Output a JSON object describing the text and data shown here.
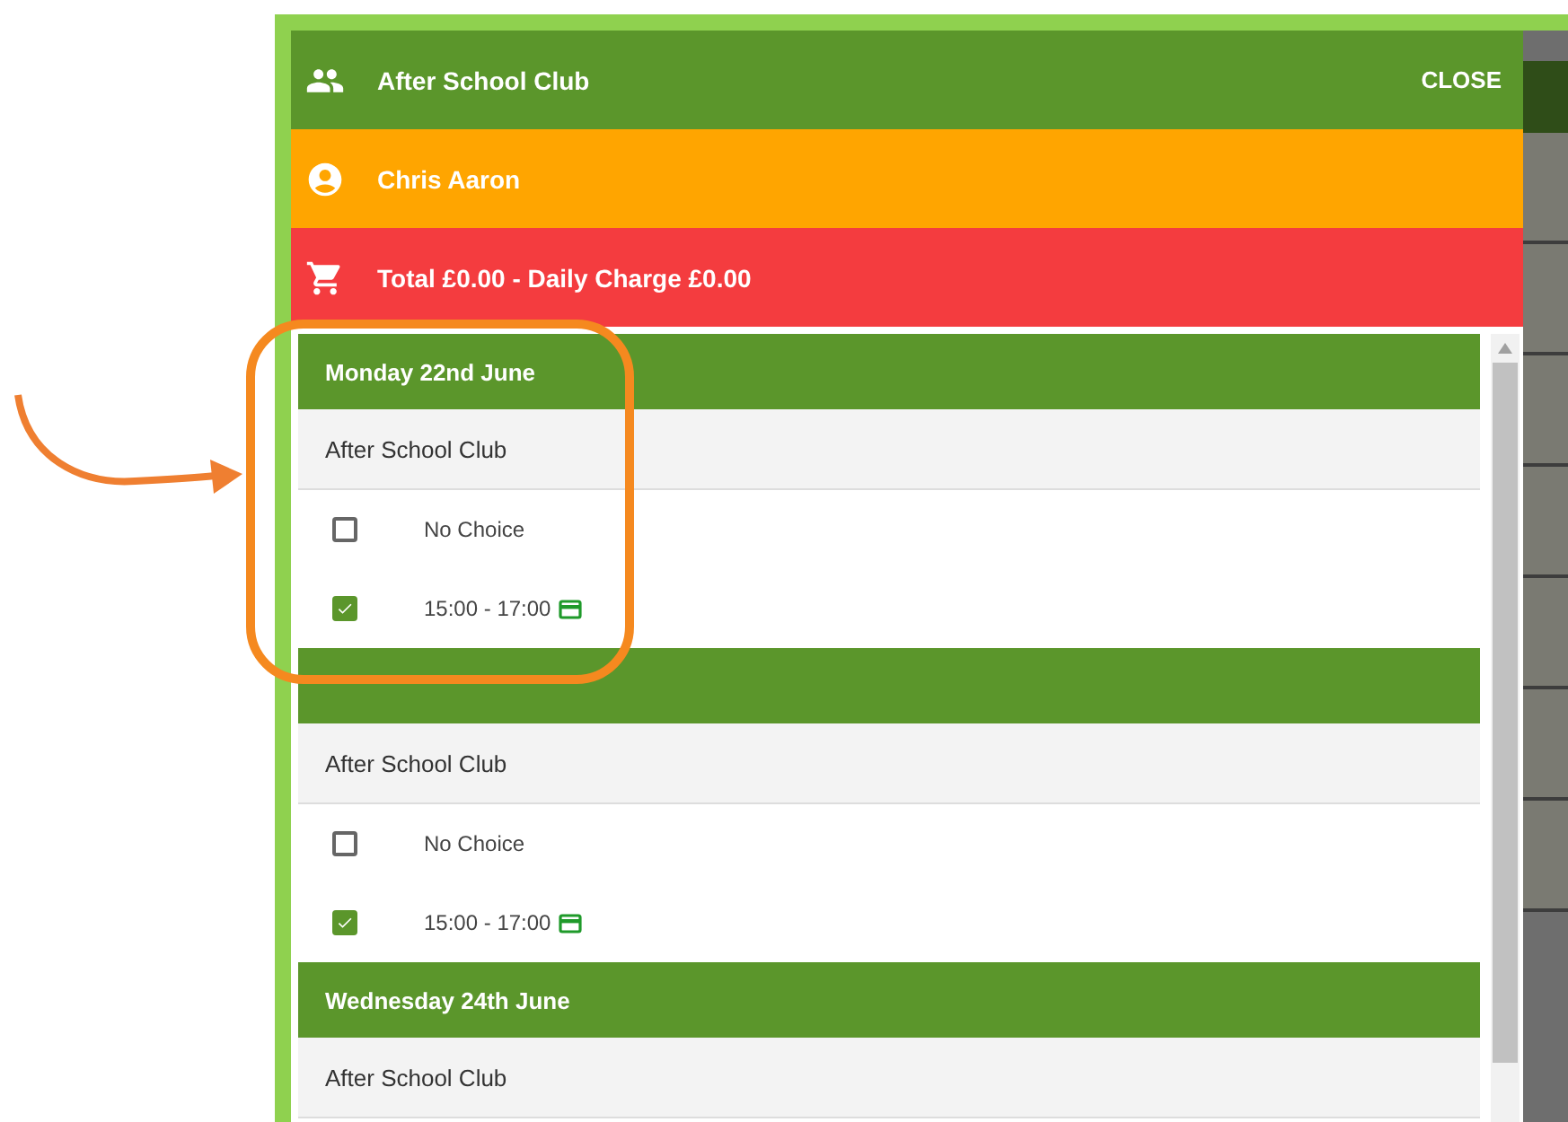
{
  "dialog": {
    "title": "After School Club",
    "close_label": "CLOSE",
    "pupil": "Chris Aaron",
    "total": "Total £0.00 - Daily Charge £0.00",
    "days": [
      {
        "date": "Monday 22nd June",
        "activity": "After School Club",
        "options": [
          {
            "label": "No Choice",
            "checked": false,
            "payment_icon": false
          },
          {
            "label": "15:00 - 17:00",
            "checked": true,
            "payment_icon": true
          }
        ]
      },
      {
        "activity": "After School Club",
        "options": [
          {
            "label": "No Choice",
            "checked": false,
            "payment_icon": false
          },
          {
            "label": "15:00 - 17:00",
            "checked": true,
            "payment_icon": true
          }
        ]
      },
      {
        "date": "Wednesday 24th June",
        "activity": "After School Club"
      }
    ]
  }
}
